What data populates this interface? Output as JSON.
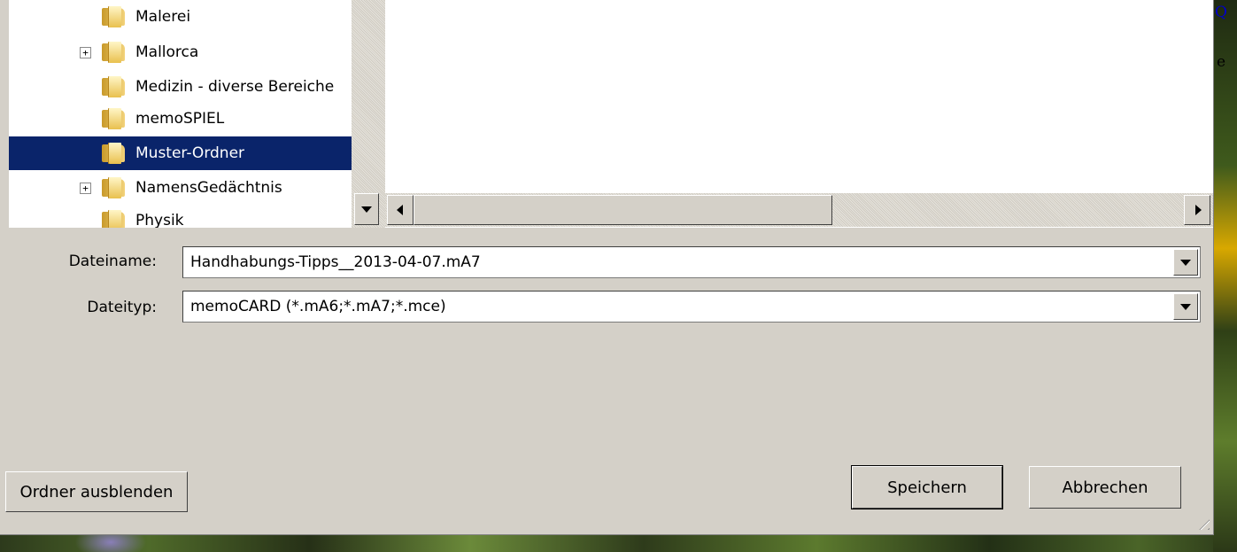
{
  "tree": {
    "items": [
      {
        "label": "Malerei",
        "expandable": false,
        "selected": false
      },
      {
        "label": "Mallorca",
        "expandable": true,
        "selected": false
      },
      {
        "label": "Medizin - diverse Bereiche",
        "expandable": false,
        "selected": false
      },
      {
        "label": "memoSPIEL",
        "expandable": false,
        "selected": false
      },
      {
        "label": "Muster-Ordner",
        "expandable": false,
        "selected": true
      },
      {
        "label": "NamensGedächtnis",
        "expandable": true,
        "selected": false
      },
      {
        "label": "Physik",
        "expandable": false,
        "selected": false
      }
    ],
    "expand_glyph": "+"
  },
  "edge": {
    "text_top": "Q",
    "text_second": "e"
  },
  "form": {
    "filename_label": "Dateiname:",
    "filename_value": "Handhabungs-Tipps__2013-04-07.mA7",
    "filetype_label": "Dateityp:",
    "filetype_value": "memoCARD (*.mA6;*.mA7;*.mce)"
  },
  "buttons": {
    "hide_folders": "Ordner ausblenden",
    "save": "Speichern",
    "cancel": "Abbrechen"
  },
  "colors": {
    "dialog_bg": "#d4d0c8",
    "selection_bg": "#0a246a",
    "selection_fg": "#ffffff"
  }
}
